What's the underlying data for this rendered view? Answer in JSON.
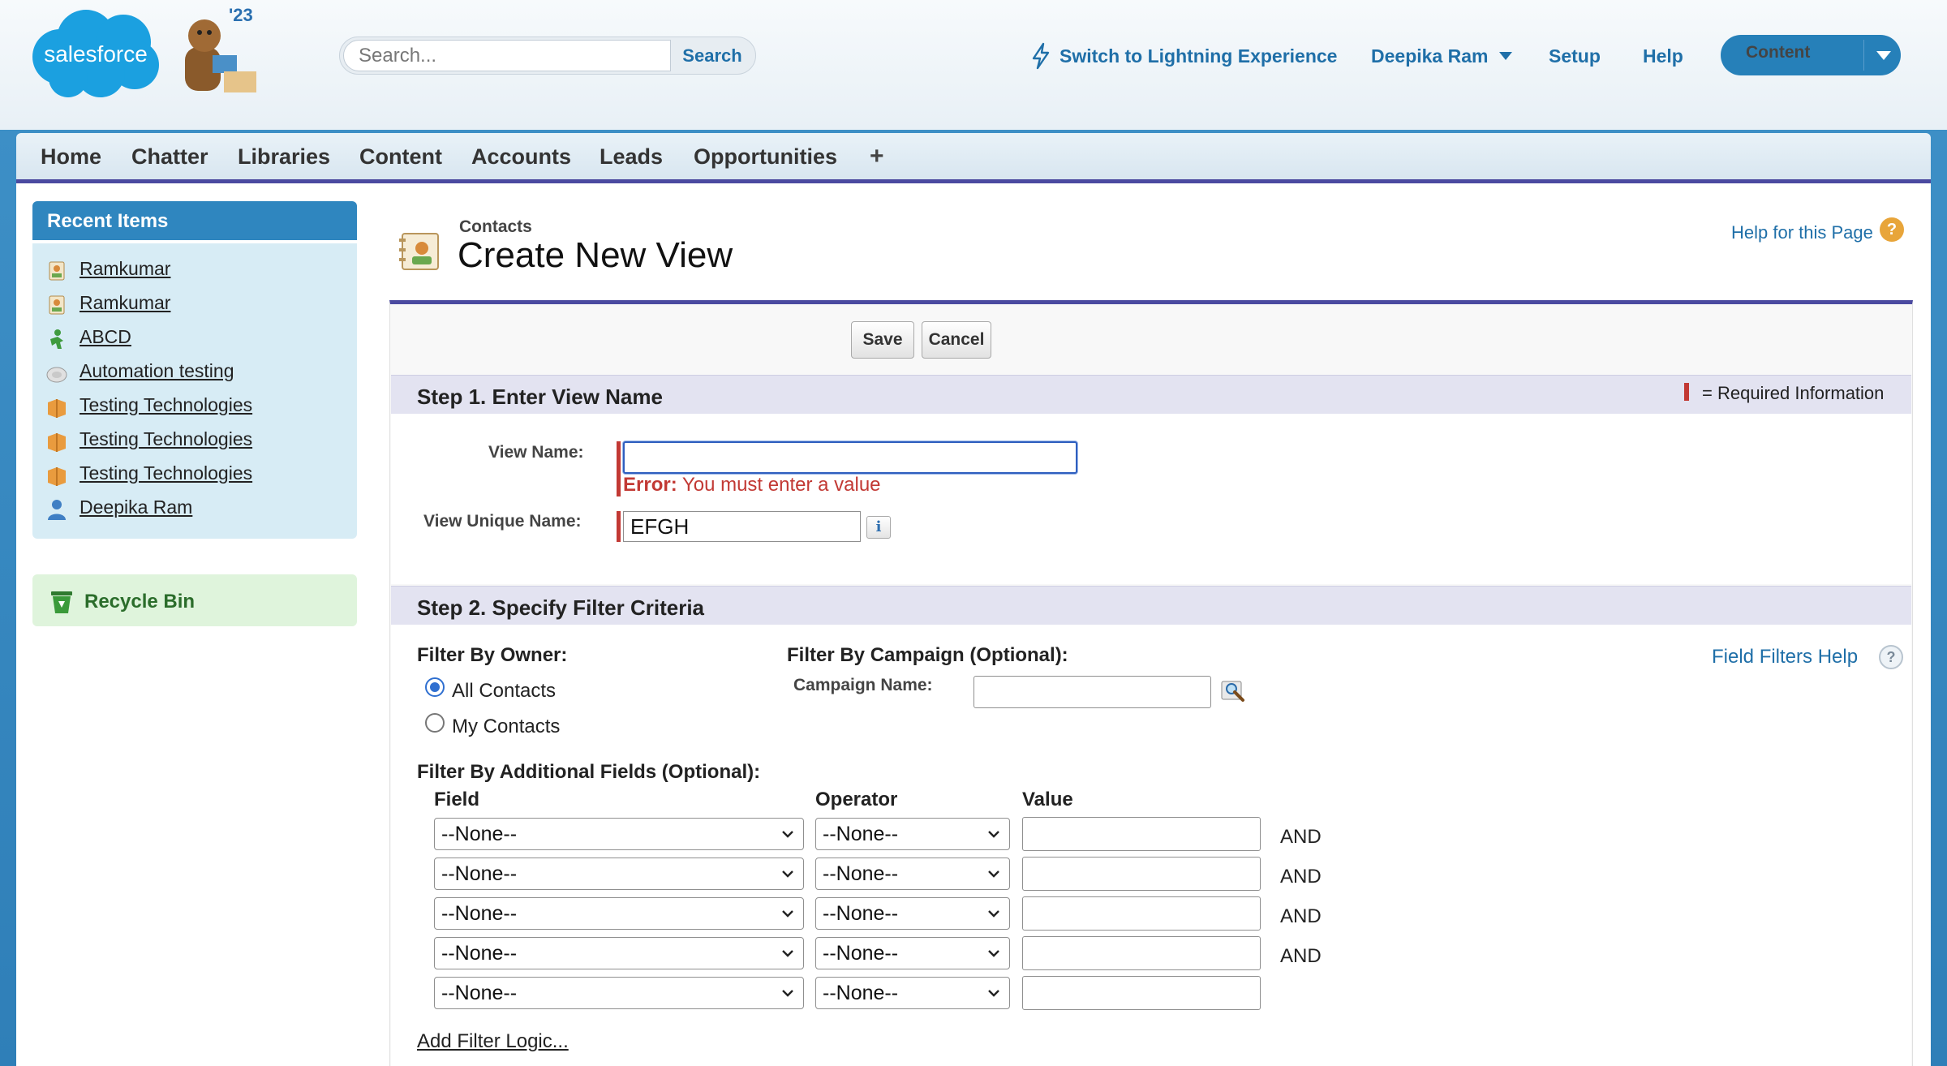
{
  "header": {
    "logo_text": "salesforce",
    "release_badge": "'23",
    "search_placeholder": "Search...",
    "search_button": "Search",
    "lightning_link": "Switch to Lightning Experience",
    "user_name": "Deepika Ram",
    "setup_link": "Setup",
    "help_link": "Help",
    "app_menu": "Content"
  },
  "tabs": [
    "Home",
    "Chatter",
    "Libraries",
    "Content",
    "Accounts",
    "Leads",
    "Opportunities"
  ],
  "tab_more": "+",
  "sidebar": {
    "recent_title": "Recent Items",
    "recent_items": [
      {
        "label": "Ramkumar",
        "icon": "contact-icon"
      },
      {
        "label": "Ramkumar",
        "icon": "contact-icon"
      },
      {
        "label": "ABCD",
        "icon": "lead-icon"
      },
      {
        "label": "Automation testing",
        "icon": "campaign-icon"
      },
      {
        "label": "Testing Technologies",
        "icon": "account-icon"
      },
      {
        "label": "Testing Technologies",
        "icon": "account-icon"
      },
      {
        "label": "Testing Technologies",
        "icon": "account-icon"
      },
      {
        "label": "Deepika Ram",
        "icon": "user-icon"
      }
    ],
    "recycle_bin": "Recycle Bin"
  },
  "page": {
    "object_type": "Contacts",
    "title": "Create New View",
    "help_link": "Help for this Page"
  },
  "buttons": {
    "save": "Save",
    "cancel": "Cancel"
  },
  "step1": {
    "title": "Step 1. Enter View Name",
    "required_info": "= Required Information",
    "view_name_label": "View Name:",
    "view_name_value": "",
    "error_prefix": "Error:",
    "error_message": "You must enter a value",
    "unique_name_label": "View Unique Name:",
    "unique_name_value": "EFGH",
    "info_button": "i"
  },
  "step2": {
    "title": "Step 2. Specify Filter Criteria",
    "owner_label": "Filter By Owner:",
    "owner_options": [
      "All Contacts",
      "My Contacts"
    ],
    "owner_selected": "All Contacts",
    "campaign_label": "Filter By Campaign (Optional):",
    "campaign_name_label": "Campaign Name:",
    "campaign_name_value": "",
    "field_filters_help": "Field Filters Help",
    "additional_label": "Filter By Additional Fields (Optional):",
    "columns": {
      "field": "Field",
      "operator": "Operator",
      "value": "Value"
    },
    "rows": [
      {
        "field": "--None--",
        "operator": "--None--",
        "value": "",
        "conjunction": "AND"
      },
      {
        "field": "--None--",
        "operator": "--None--",
        "value": "",
        "conjunction": "AND"
      },
      {
        "field": "--None--",
        "operator": "--None--",
        "value": "",
        "conjunction": "AND"
      },
      {
        "field": "--None--",
        "operator": "--None--",
        "value": "",
        "conjunction": "AND"
      },
      {
        "field": "--None--",
        "operator": "--None--",
        "value": "",
        "conjunction": ""
      }
    ],
    "add_filter_logic": "Add Filter Logic..."
  },
  "colors": {
    "brand_blue": "#2680b9",
    "link_blue": "#1f6fa8",
    "tab_underline": "#4b4aa0",
    "error_red": "#c23934",
    "step_bar": "#e3e3f1"
  }
}
